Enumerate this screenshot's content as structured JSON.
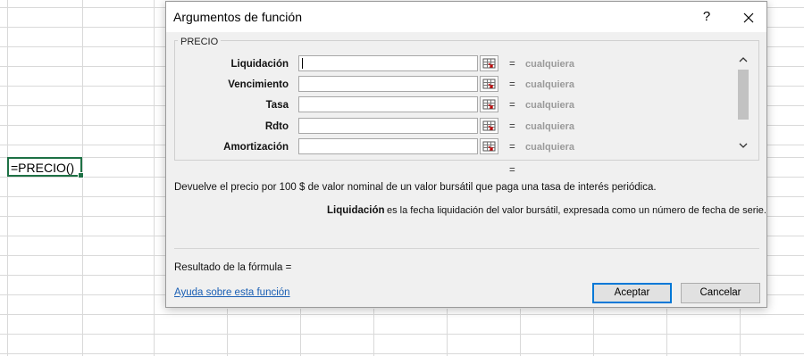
{
  "sheet": {
    "active_cell_text": "=PRECIO()"
  },
  "dialog": {
    "title": "Argumentos de función",
    "help_glyph": "?",
    "close_glyph": "✕",
    "group_label": "PRECIO",
    "arguments": [
      {
        "label": "Liquidación",
        "value": "",
        "result": "cualquiera"
      },
      {
        "label": "Vencimiento",
        "value": "",
        "result": "cualquiera"
      },
      {
        "label": "Tasa",
        "value": "",
        "result": "cualquiera"
      },
      {
        "label": "Rdto",
        "value": "",
        "result": "cualquiera"
      },
      {
        "label": "Amortización",
        "value": "",
        "result": "cualquiera"
      }
    ],
    "equals_sign": "=",
    "description": "Devuelve el precio por 100 $ de valor nominal de un valor bursátil que paga una tasa de interés periódica.",
    "param_name": "Liquidación",
    "param_description": "es la fecha liquidación del valor bursátil, expresada como un número de fecha de serie.",
    "formula_result_label": "Resultado de la fórmula =",
    "help_link": "Ayuda sobre esta función",
    "ok_label": "Aceptar",
    "cancel_label": "Cancelar",
    "scroll_up_glyph": "^",
    "scroll_down_glyph": "v"
  },
  "colors": {
    "dialog_bg": "#f0f0f0",
    "link": "#1a5fb4",
    "ok_border": "#0078d7",
    "cell_border": "#1e7145",
    "muted_value": "#9a9a9a"
  }
}
